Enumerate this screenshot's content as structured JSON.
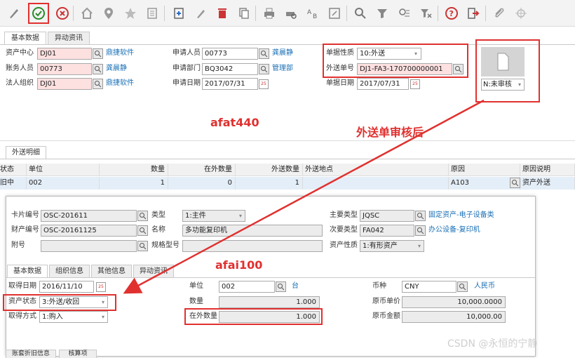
{
  "toolbar": {
    "icons": [
      "edit-pen-icon",
      "confirm-icon",
      "cancel-icon",
      "home-icon",
      "location-icon",
      "star-icon",
      "list-icon",
      "add-icon",
      "pencil-icon",
      "delete-icon",
      "copy-icon",
      "print-icon",
      "print-preview-icon",
      "transform-icon",
      "export-icon",
      "search-icon",
      "filter-icon",
      "query-icon",
      "clear-filter-icon",
      "help-icon",
      "exit-icon",
      "attachment-icon",
      "crosshair-icon"
    ]
  },
  "afat440": {
    "tabs": [
      "基本数据",
      "异动资讯"
    ],
    "header": {
      "asset_center_label": "资产中心",
      "asset_center_value": "DJ01",
      "asset_center_desc": "鼎捷软件",
      "account_person_label": "账务人员",
      "account_person_value": "00773",
      "account_person_desc": "龚晨静",
      "legal_org_label": "法人组织",
      "legal_org_value": "DJ01",
      "legal_org_desc": "鼎捷软件",
      "applicant_label": "申请人员",
      "applicant_value": "00773",
      "applicant_desc": "龚晨静",
      "apply_dept_label": "申请部门",
      "apply_dept_value": "BQ3042",
      "apply_dept_desc": "管理部",
      "apply_date_label": "申请日期",
      "apply_date_value": "2017/07/31",
      "doc_nature_label": "单据性质",
      "doc_nature_value": "10:外送",
      "send_no_label": "外送单号",
      "send_no_value": "DJ1-FA3-170700000001",
      "doc_date_label": "单据日期",
      "doc_date_value": "2017/07/31",
      "status_value": "N:未审核"
    },
    "detail_tab": "外送明细",
    "detail_columns": [
      "状态",
      "单位",
      "数量",
      "在外数量",
      "外送数量",
      "外送地点",
      "原因",
      "原因说明"
    ],
    "detail_row": {
      "status": "旧中",
      "unit": "002",
      "qty": "1",
      "out_qty": "0",
      "send_qty": "1",
      "place": "",
      "reason": "A103",
      "reason_desc": "资产外送"
    }
  },
  "annotations": {
    "afat440": "afat440",
    "after_approve": "外送单审核后",
    "afai100": "afai100"
  },
  "afai100": {
    "card_no_label": "卡片编号",
    "card_no_value": "OSC-201611",
    "property_no_label": "财产编号",
    "property_no_value": "OSC-20161125",
    "attach_no_label": "附号",
    "attach_no_value": "",
    "type_label": "类型",
    "type_value": "1:主件",
    "name_label": "名称",
    "name_value": "多功能复印机",
    "spec_label": "规格型号",
    "spec_value": "",
    "main_type_label": "主要类型",
    "main_type_value": "JQSC",
    "main_type_desc": "固定资产-电子设备类",
    "sub_type_label": "次要类型",
    "sub_type_value": "FA042",
    "sub_type_desc": "办公设备-复印机",
    "nature_label": "资产性质",
    "nature_value": "1:有形资产",
    "tabs": [
      "基本数据",
      "组织信息",
      "其他信息",
      "异动资讯"
    ],
    "acquire_date_label": "取得日期",
    "acquire_date_value": "2016/11/10",
    "asset_status_label": "资产状态",
    "asset_status_value": "3:外送/收回",
    "acquire_method_label": "取得方式",
    "acquire_method_value": "1:购入",
    "unit_label": "单位",
    "unit_value": "002",
    "unit_desc": "台",
    "qty_label": "数量",
    "qty_value": "1.000",
    "out_qty_label": "在外数量",
    "out_qty_value": "1.000",
    "currency_label": "币种",
    "currency_value": "CNY",
    "currency_desc": "人民币",
    "orig_price_label": "原币单价",
    "orig_price_value": "10,000.0000",
    "orig_amount_label": "原币金额",
    "orig_amount_value": "10,000.00",
    "bottom_tabs": [
      "账套折旧信息",
      "核算项"
    ]
  },
  "watermark": "CSDN @永恒的宁静",
  "colors": {
    "annotation_red": "#e0312f",
    "link_blue": "#1a6fb5",
    "required_pink": "#fde0e0"
  }
}
